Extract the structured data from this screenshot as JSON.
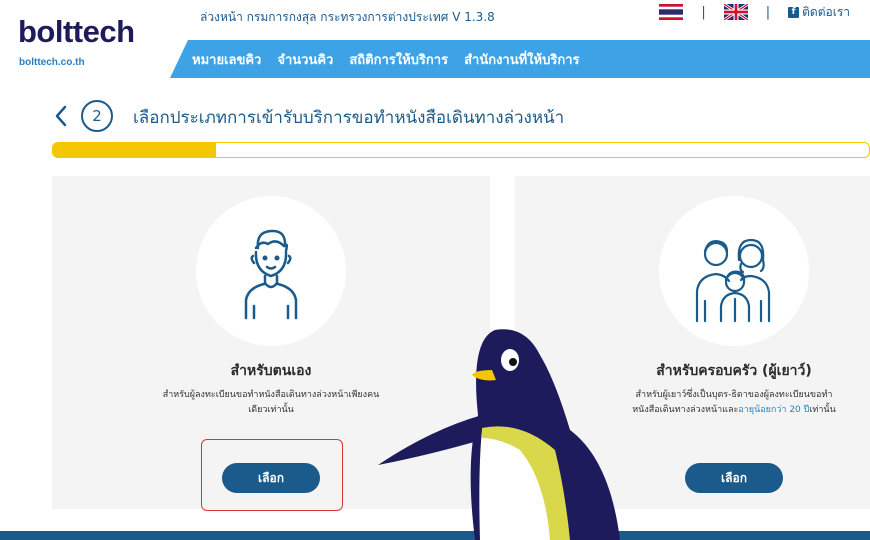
{
  "header": {
    "logo_text": "bolttech",
    "logo_url": "bolttech.co.th",
    "system_title": "ล่วงหน้า กรมการกงสุล กระทรวงการต่างประเทศ V 1.3.8",
    "contact_label": "ติดต่อเรา",
    "languages": [
      "thai-flag",
      "uk-flag"
    ]
  },
  "nav": {
    "items": [
      {
        "label": "หมายเลขคิว"
      },
      {
        "label": "จำนวนคิว"
      },
      {
        "label": "สถิติการให้บริการ"
      },
      {
        "label": "สำนักงานที่ให้บริการ"
      }
    ]
  },
  "step": {
    "number": "2",
    "title": "เลือกประเภทการเข้ารับบริการขอทำหนังสือเดินทางล่วงหน้า",
    "progress": 0.2
  },
  "cards": {
    "self": {
      "title": "สำหรับตนเอง",
      "desc": "สำหรับผู้ลงทะเบียนขอทำหนังสือเดินทางล่วงหน้าเพียงคนเดียวเท่านั้น",
      "button": "เลือก"
    },
    "family": {
      "title": "สำหรับครอบครัว (ผู้เยาว์)",
      "desc_a": "สำหรับผู้เยาว์ซึ่งเป็นบุตร-ธิดาของผู้ลงทะเบียนขอทำหนังสือเดินทางล่วงหน้าและ",
      "desc_link": "อายุน้อยกว่า 20 ปี",
      "desc_b": "เท่านั้น",
      "button": "เลือก"
    }
  },
  "colors": {
    "primary": "#1a5b8c",
    "nav": "#3da3e6",
    "accent": "#f3c600",
    "card_bg": "#f4f4f4"
  }
}
